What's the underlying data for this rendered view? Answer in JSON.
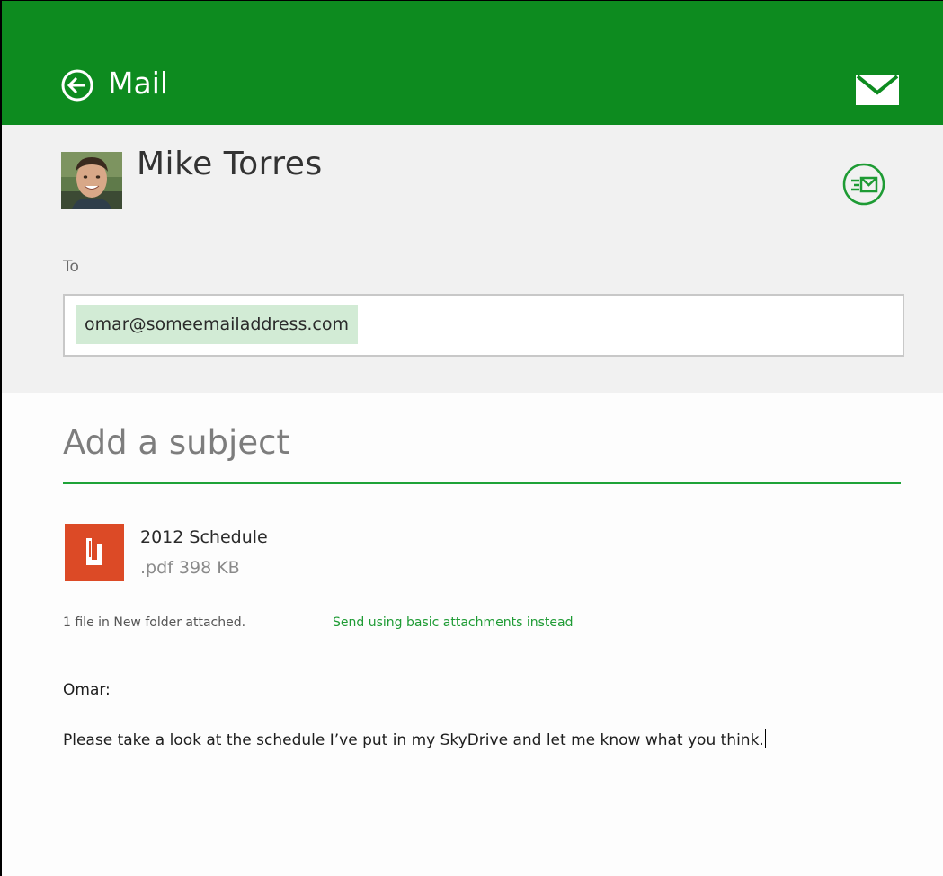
{
  "app": {
    "title": "Mail",
    "accent_color": "#0d8b1f",
    "back_icon": "back-arrow-circle-icon",
    "mail_icon": "envelope-icon"
  },
  "sender": {
    "name": "Mike Torres",
    "avatar_icon": "avatar"
  },
  "actions": {
    "send_icon": "send-mail-icon"
  },
  "to": {
    "label": "To",
    "recipients": [
      "omar@someemailaddress.com"
    ]
  },
  "subject": {
    "placeholder": "Add a subject"
  },
  "attachment": {
    "name": "2012 Schedule",
    "meta": ".pdf 398 KB",
    "icon": "pdf-file-icon",
    "status": "1 file in New folder attached.",
    "link": "Send using basic attachments instead"
  },
  "body": {
    "greeting": "Omar:",
    "text": "Please take a look at the schedule I’ve put in my SkyDrive and let me know what you think."
  }
}
